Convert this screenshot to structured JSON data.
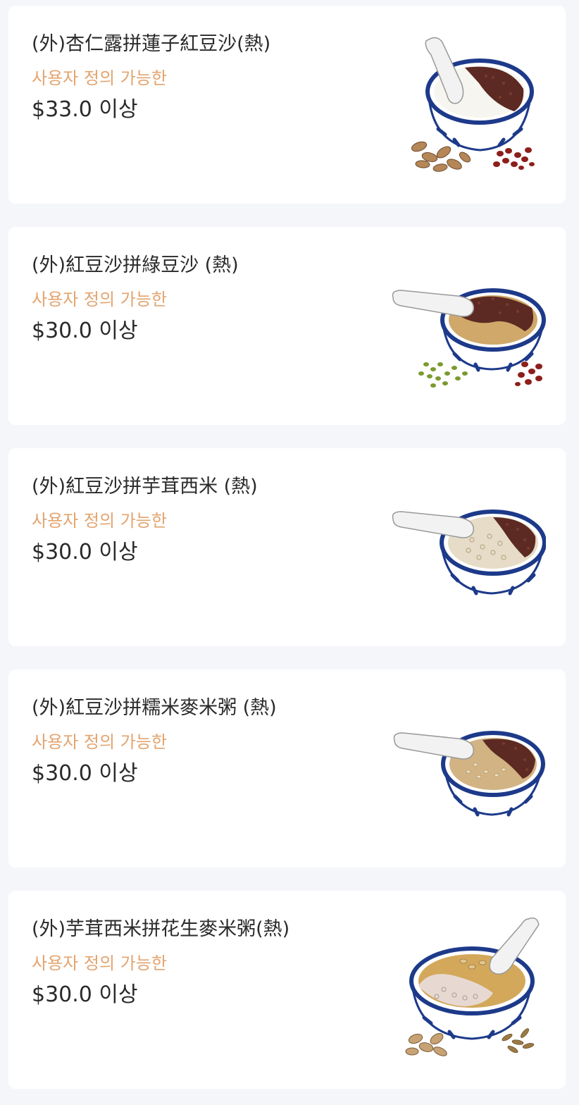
{
  "menu": {
    "items": [
      {
        "name": "(外)杏仁露拼蓮子紅豆沙(熱)",
        "customizable": "사용자 정의 가능한",
        "price": "$33.0 이상",
        "image": "dessert-bowl-almond-red-bean-illustration"
      },
      {
        "name": "(外)紅豆沙拼綠豆沙 (熱)",
        "customizable": "사용자 정의 가능한",
        "price": "$30.0 이상",
        "image": "dessert-bowl-red-bean-mung-bean-illustration"
      },
      {
        "name": "(外)紅豆沙拼芋茸西米 (熱)",
        "customizable": "사용자 정의 가능한",
        "price": "$30.0 이상",
        "image": "dessert-bowl-red-bean-taro-sago-illustration"
      },
      {
        "name": "(外)紅豆沙拼糯米麥米粥 (熱)",
        "customizable": "사용자 정의 가능한",
        "price": "$30.0 이상",
        "image": "dessert-bowl-red-bean-glutinous-rice-illustration"
      },
      {
        "name": "(外)芋茸西米拼花生麥米粥(熱)",
        "customizable": "사용자 정의 가능한",
        "price": "$30.0 이상",
        "image": "dessert-bowl-taro-sago-peanut-illustration"
      }
    ]
  },
  "colors": {
    "background": "#f5f6fa",
    "card": "#ffffff",
    "name_text": "#2a2a2a",
    "custom_text": "#e3a46f",
    "price_text": "#2a2a2a",
    "bowl_rim": "#1d3a8a"
  }
}
